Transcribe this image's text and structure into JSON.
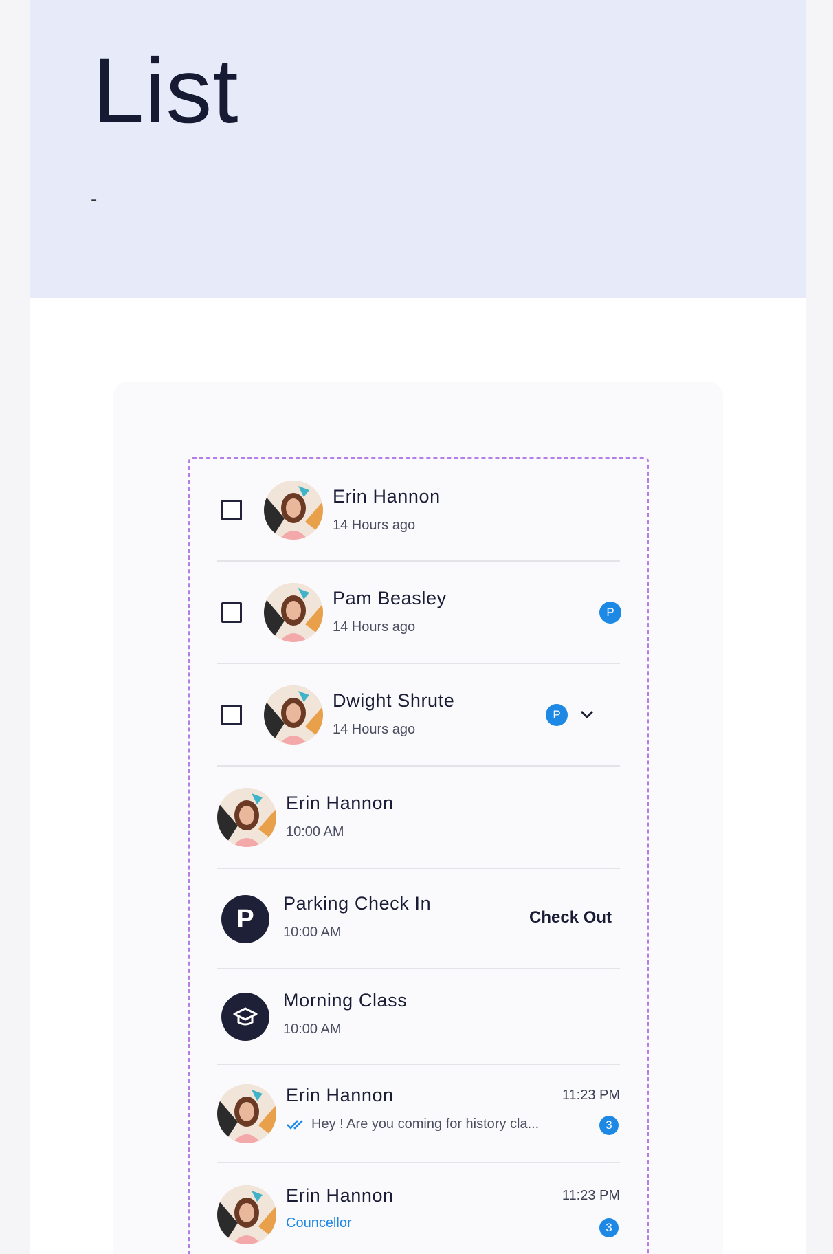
{
  "page": {
    "title": "List",
    "subtitle": "-"
  },
  "colors": {
    "hero_bg": "#e7eaf8",
    "accent": "#1e88e5",
    "dashed_border": "#b57ee6",
    "dark_icon_bg": "#1e2038"
  },
  "list": {
    "items": [
      {
        "type": "checkbox-avatar",
        "checked": false,
        "name": "Erin Hannon",
        "meta": "14 Hours ago"
      },
      {
        "type": "checkbox-avatar-badge",
        "checked": false,
        "name": "Pam Beasley",
        "meta": "14 Hours ago",
        "badge": "P"
      },
      {
        "type": "checkbox-avatar-badge-expand",
        "checked": false,
        "name": "Dwight Shrute",
        "meta": "14 Hours ago",
        "badge": "P",
        "icon": "chevron-down-icon"
      },
      {
        "type": "avatar",
        "name": "Erin Hannon",
        "meta": "10:00 AM"
      },
      {
        "type": "icon-action",
        "icon_letter": "P",
        "icon": "parking-icon",
        "name": "Parking Check In",
        "meta": "10:00 AM",
        "action": "Check Out"
      },
      {
        "type": "icon",
        "icon": "graduation-cap-icon",
        "name": "Morning Class",
        "meta": "10:00 AM"
      },
      {
        "type": "chat",
        "name": "Erin Hannon",
        "time": "11:23 PM",
        "message": "Hey ! Are you coming for history cla...",
        "unread": "3",
        "icon": "double-check-icon"
      },
      {
        "type": "chat-role",
        "name": "Erin Hannon",
        "time": "11:23 PM",
        "role": "Councellor",
        "unread": "3"
      }
    ]
  }
}
